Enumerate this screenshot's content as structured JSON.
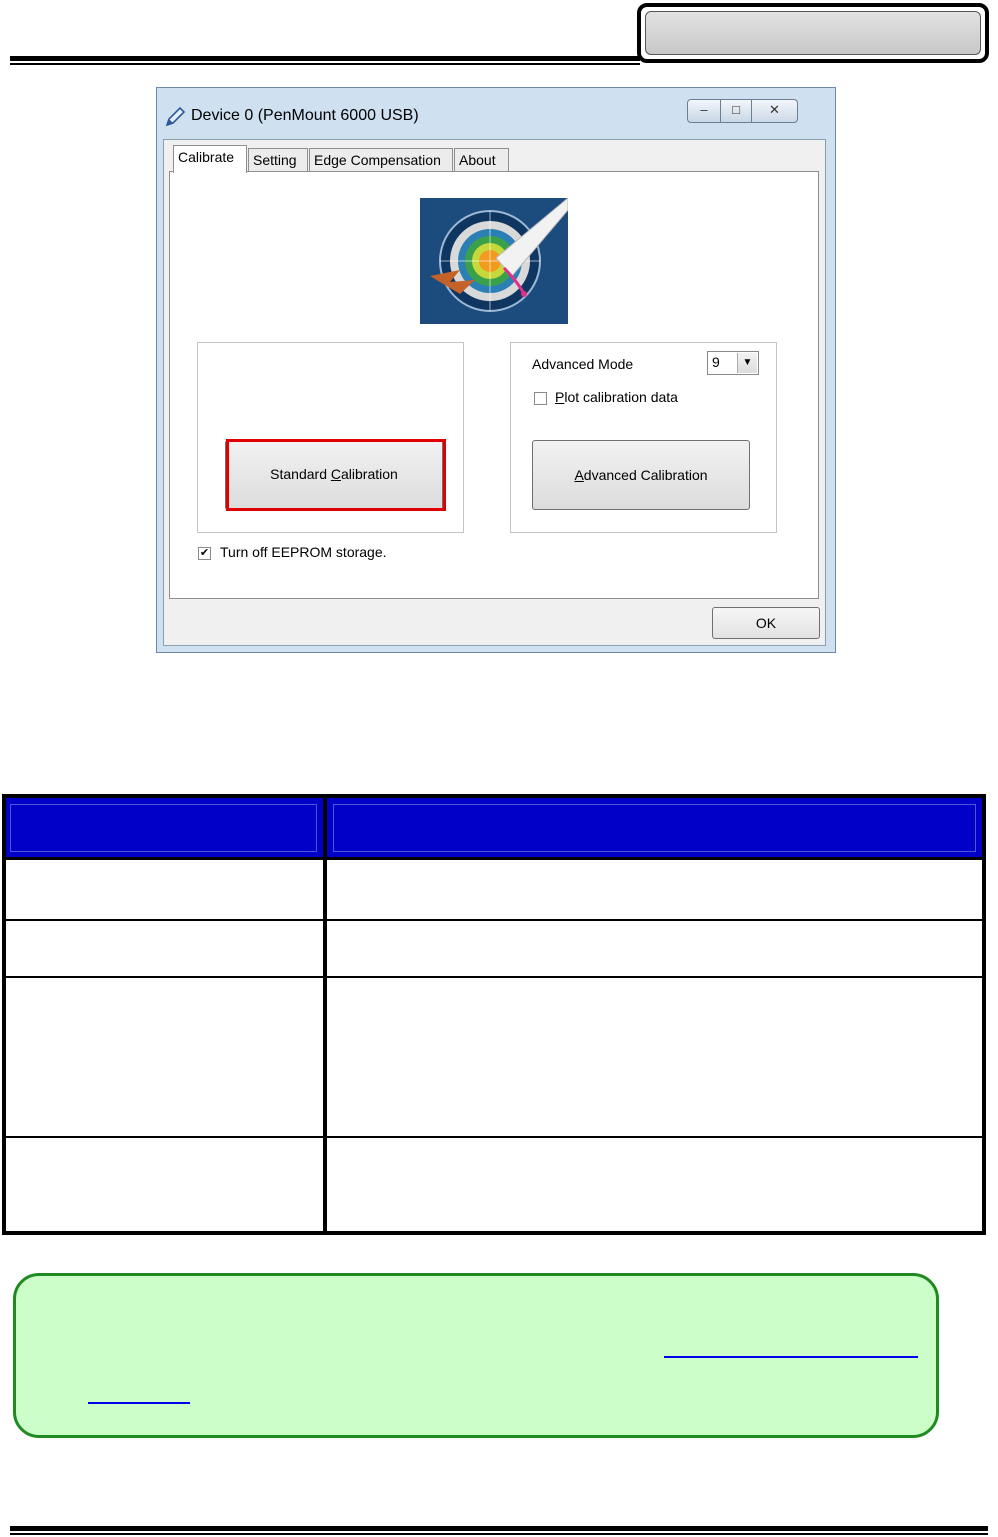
{
  "window": {
    "title": "Device 0 (PenMount 6000 USB)",
    "minimize_glyph": "–",
    "maximize_glyph": "□",
    "close_glyph": "✕"
  },
  "tabs": [
    "Calibrate",
    "Setting",
    "Edge Compensation",
    "About"
  ],
  "calibrate": {
    "standard_pre": "Standard ",
    "standard_ul": "C",
    "standard_post": "alibration",
    "advanced_mode_label": "Advanced Mode",
    "advanced_mode_value": "9",
    "plot_ul": "P",
    "plot_post": "lot calibration data",
    "plot_checked": false,
    "advanced_ul": "A",
    "advanced_post": "dvanced Calibration",
    "eeprom_label": "Turn off EEPROM storage.",
    "eeprom_checked": true,
    "ok_label": "OK",
    "check_glyph": "✔",
    "dropdown_glyph": "▼"
  },
  "colors": {
    "table_header": "#0000c8",
    "note_background": "#ccfec9",
    "note_border": "#1f8a1f",
    "highlight": "#e00000"
  }
}
